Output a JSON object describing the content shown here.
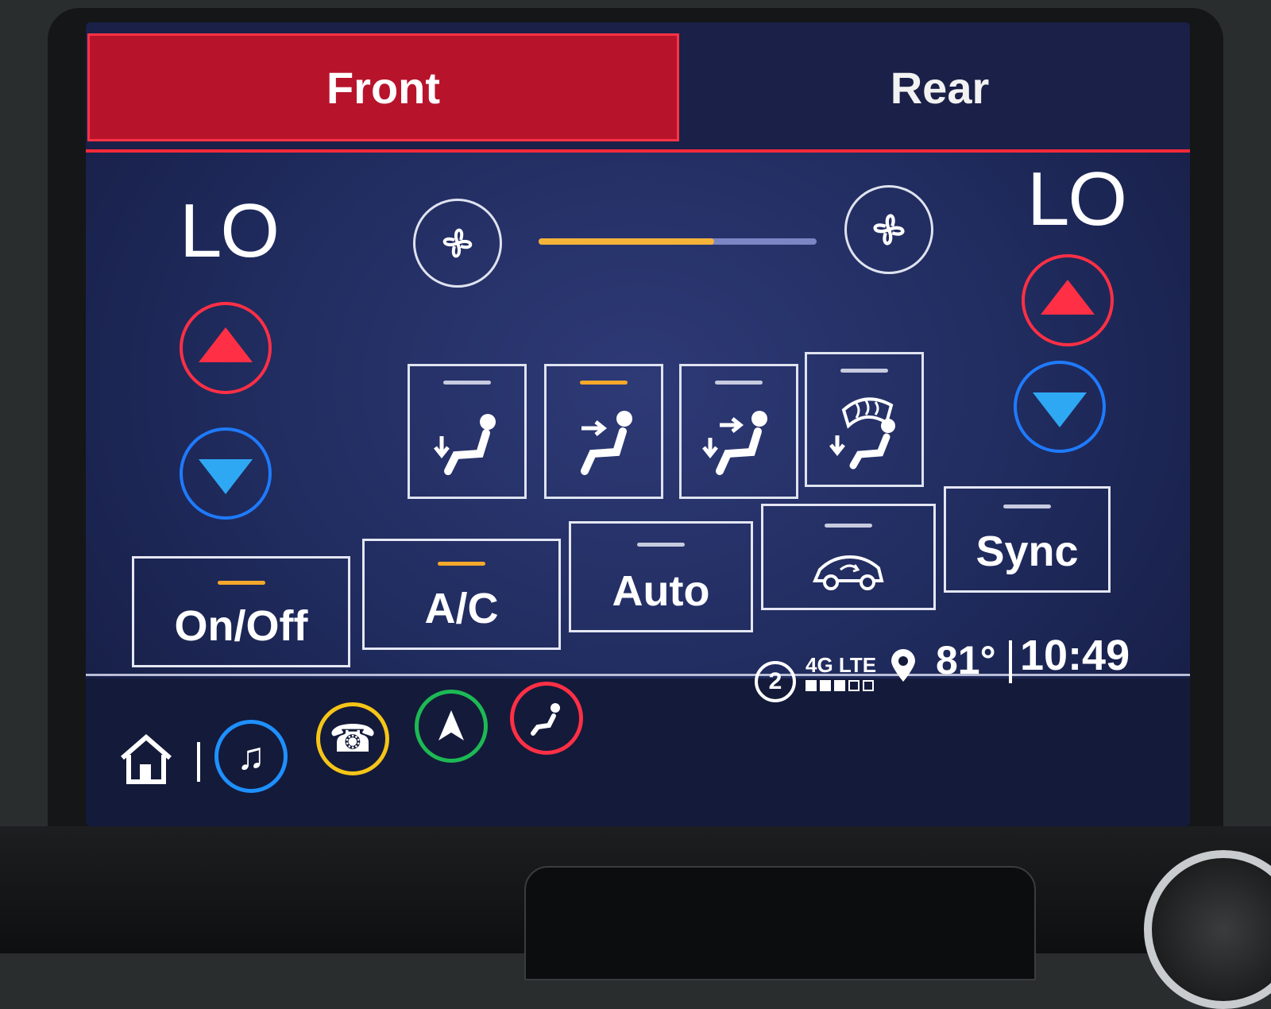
{
  "tabs": {
    "front": "Front",
    "rear": "Rear"
  },
  "left_zone": {
    "temp": "LO"
  },
  "right_zone": {
    "temp": "LO"
  },
  "fan": {
    "level": 0.63,
    "low_icon": "fan-icon",
    "high_icon": "fan-icon"
  },
  "modes": [
    {
      "icon": "vent-floor-icon",
      "active": false
    },
    {
      "icon": "vent-face-icon",
      "active": true
    },
    {
      "icon": "vent-face-floor-icon",
      "active": false
    },
    {
      "icon": "defrost-floor-icon",
      "active": false
    }
  ],
  "controls": {
    "onoff": "On/Off",
    "ac": "A/C",
    "auto": "Auto",
    "recirc_icon": "recirculation-icon",
    "sync": "Sync"
  },
  "status": {
    "notifications": "2",
    "network": "4G LTE",
    "temperature": "81°",
    "time": "10:49"
  },
  "colors": {
    "active_tab": "#b7142c",
    "accent_red": "#ff2f45",
    "accent_blue": "#1e7bff",
    "indicator_on": "#f5a82a"
  },
  "nav": [
    {
      "icon": "home-icon"
    },
    {
      "icon": "music-icon",
      "color": "#1e90ff"
    },
    {
      "icon": "phone-icon",
      "color": "#f5c518"
    },
    {
      "icon": "navigation-icon",
      "color": "#1db954"
    },
    {
      "icon": "climate-icon",
      "color": "#ff2f45"
    }
  ]
}
